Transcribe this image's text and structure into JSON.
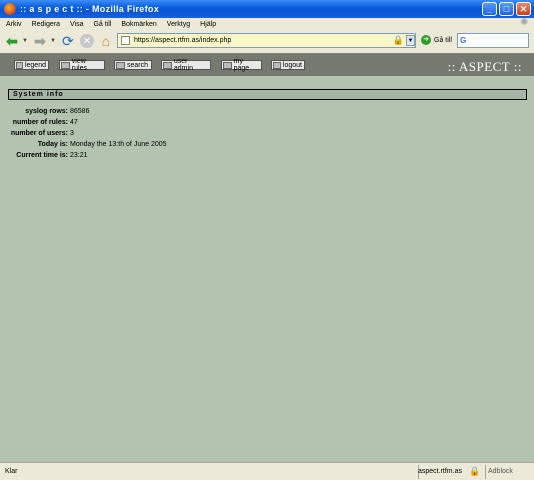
{
  "window": {
    "title": ":: a s p e c t :: - Mozilla Firefox",
    "minimize": "_",
    "maximize": "□",
    "close": "✕"
  },
  "menu": [
    "Arkiv",
    "Redigera",
    "Visa",
    "Gå till",
    "Bokmärken",
    "Verktyg",
    "Hjälp"
  ],
  "toolbar": {
    "url": "https://aspect.rtfm.as/index.php",
    "go_label": "Gå till",
    "search_placeholder": "G"
  },
  "site": {
    "brand": ":: ASPECT ::",
    "nav": [
      "legend",
      "view rules",
      "search",
      "user admin",
      "my page",
      "logout"
    ],
    "section_title": "System info",
    "info": [
      {
        "label": "syslog rows:",
        "value": "86586"
      },
      {
        "label": "number of rules:",
        "value": "47"
      },
      {
        "label": "number of users:",
        "value": "3"
      },
      {
        "label": "Today is:",
        "value": "Monday the 13:th of June 2005"
      },
      {
        "label": "Current time is:",
        "value": "23:21"
      }
    ]
  },
  "statusbar": {
    "text": "Klar",
    "host": "aspect.rtfm.as",
    "adblock": "Adblock"
  },
  "colors": {
    "page_bg": "#b3c3af",
    "header_bar": "#75796f",
    "section_header": "#a4b6a3"
  }
}
